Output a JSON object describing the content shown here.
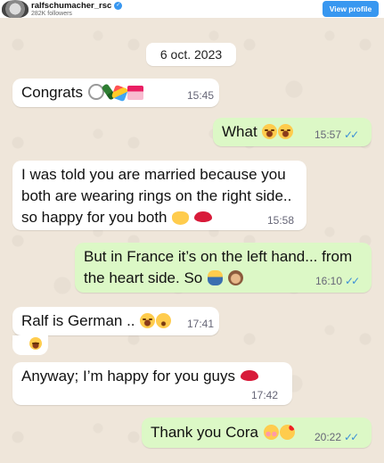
{
  "header": {
    "handle": "ralfschumacher_rsc",
    "verified_glyph": "✓",
    "followers": "282K followers",
    "view_profile": "View profile"
  },
  "date_label": "6 oct. 2023",
  "colors": {
    "incoming_bubble": "#ffffff",
    "outgoing_bubble": "#dcf8c6",
    "read_ticks": "#3b8fd6",
    "view_button": "#3897f0"
  },
  "messages": [
    {
      "direction": "in",
      "text": "Congrats",
      "emoji": [
        "ring-emoji",
        "champagne-emoji",
        "party-popper-emoji",
        "wedding-chapel-emoji"
      ],
      "time": "15:45"
    },
    {
      "direction": "out",
      "text": "What",
      "emoji": [
        "tears-of-joy-emoji",
        "tears-of-joy-emoji"
      ],
      "time": "15:57",
      "ticks": "✓✓"
    },
    {
      "direction": "in",
      "line1": "I was told you are married because you",
      "line2": "both are wearing rings on the right side..",
      "line3": "so happy for you both",
      "emoji": [
        "hands-emoji",
        "kiss-mark-emoji"
      ],
      "time": "15:58"
    },
    {
      "direction": "out",
      "line1": "But in France it’s on the left hand... from",
      "line2": "the heart side. So",
      "emoji": [
        "shrug-emoji",
        "see-no-evil-monkey-emoji"
      ],
      "time": "16:10",
      "ticks": "✓✓"
    },
    {
      "direction": "in",
      "text": "Ralf is German ..",
      "emoji": [
        "tears-of-joy-emoji",
        "winking-face-emoji"
      ],
      "time": "17:41"
    },
    {
      "direction": "in",
      "text": "",
      "emoji": [
        "tears-of-joy-emoji"
      ]
    },
    {
      "direction": "in",
      "text": "Anyway; I’m happy for you guys",
      "emoji": [
        "kiss-mark-emoji"
      ],
      "time": "17:42"
    },
    {
      "direction": "out",
      "text": "Thank you Cora",
      "emoji": [
        "smiling-blush-emoji",
        "smiling-hearts-emoji"
      ],
      "time": "20:22",
      "ticks": "✓✓"
    }
  ]
}
